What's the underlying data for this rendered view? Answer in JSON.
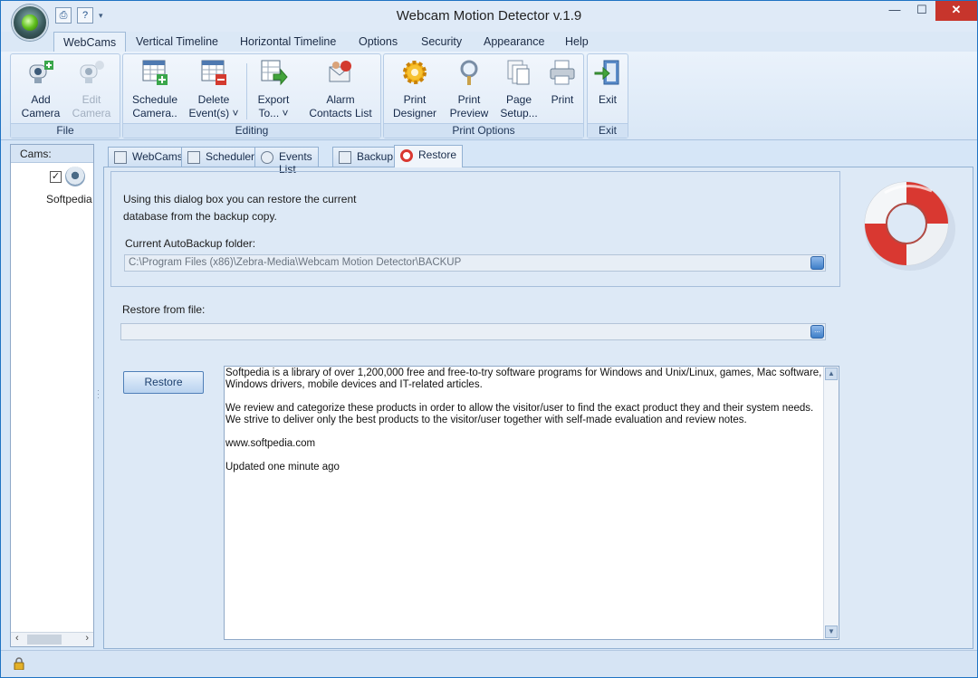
{
  "window": {
    "title": "Webcam Motion Detector v.1.9"
  },
  "qat": {
    "print_icon": "printer-icon",
    "help_icon": "help-icon",
    "dropdown": "▾"
  },
  "window_controls": {
    "minimize": "—",
    "maximize": "☐",
    "close": "✕"
  },
  "ribbon_tabs": [
    "WebCams",
    "Vertical Timeline",
    "Horizontal Timeline",
    "Options",
    "Security",
    "Appearance",
    "Help"
  ],
  "ribbon": {
    "file": {
      "label": "File",
      "add_camera_1": "Add",
      "add_camera_2": "Camera",
      "edit_camera_1": "Edit",
      "edit_camera_2": "Camera"
    },
    "editing": {
      "label": "Editing",
      "schedule_1": "Schedule",
      "schedule_2": "Camera..",
      "delete_1": "Delete",
      "delete_2": "Event(s) ˅",
      "export_1": "Export",
      "export_2": "To... ˅",
      "alarm_1": "Alarm",
      "alarm_2": "Contacts List"
    },
    "print_options": {
      "label": "Print Options",
      "designer_1": "Print",
      "designer_2": "Designer",
      "preview_1": "Print",
      "preview_2": "Preview",
      "setup_1": "Page",
      "setup_2": "Setup...",
      "print": "Print"
    },
    "exit": {
      "label": "Exit",
      "exit_btn": "Exit"
    }
  },
  "sidebar": {
    "header": "Cams:",
    "camera_name": "Softpedia",
    "checked": "✓"
  },
  "content_tabs": [
    "WebCams",
    "Scheduler",
    "Events List",
    "Backup",
    "Restore"
  ],
  "restore": {
    "intro_line1": "Using this dialog box you can restore the current",
    "intro_line2": "database from the backup copy.",
    "autobackup_label": "Current AutoBackup folder:",
    "autobackup_value": "C:\\Program Files (x86)\\Zebra-Media\\Webcam Motion Detector\\BACKUP",
    "from_file_label": "Restore from file:",
    "from_file_value": "",
    "browse_glyph": "...",
    "button": "Restore"
  },
  "memo": {
    "p1": "Softpedia is a library of over 1,200,000 free and free-to-try software programs for Windows and Unix/Linux, games, Mac software, Windows drivers, mobile devices and IT-related articles.",
    "p2": "We review and categorize these products in order to allow the visitor/user to find the exact product they and their system needs. We strive to deliver only the best products to the visitor/user together with self-made evaluation and review notes.",
    "p3": "www.softpedia.com",
    "p4": "Updated one minute ago",
    "scroll_up": "▲",
    "scroll_down": "▼"
  },
  "colors": {
    "accent": "#1f73c3",
    "close_red": "#c7352c",
    "lifebuoy_red": "#d93831"
  }
}
